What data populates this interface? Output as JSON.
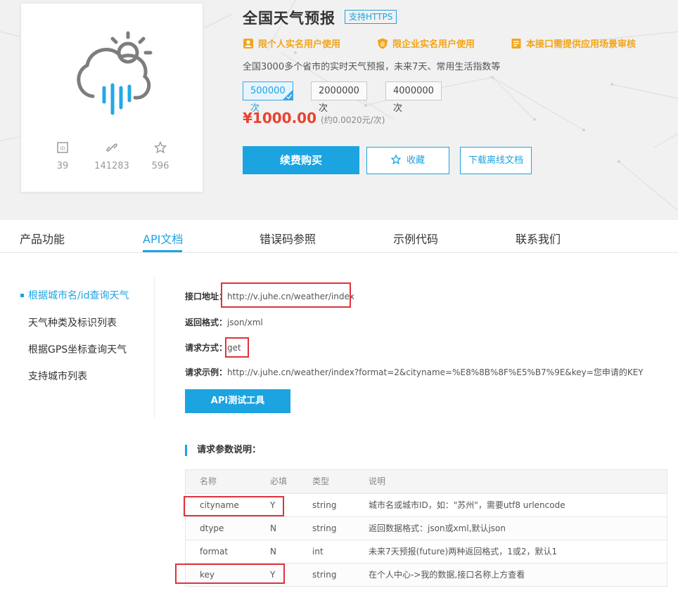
{
  "product": {
    "title": "全国天气预报",
    "https_badge": "支持HTTPS",
    "tags": [
      "限个人实名用户使用",
      "限企业实名用户使用",
      "本接口需提供应用场景审核"
    ],
    "description": "全国3000多个省市的实时天气预报，未来7天、常用生活指数等",
    "packages": [
      "500000次",
      "2000000次",
      "4000000次"
    ],
    "selected_package": "500000次",
    "price": "¥1000.00",
    "unit_price": "(约0.0020元/次)",
    "buttons": {
      "buy": "续费购买",
      "favorite": "收藏",
      "download": "下载离线文档"
    },
    "stats": [
      {
        "icon": "id-icon",
        "value": "39"
      },
      {
        "icon": "link-icon",
        "value": "141283"
      },
      {
        "icon": "star-icon",
        "value": "596"
      }
    ]
  },
  "tabs": [
    "产品功能",
    "API文档",
    "错误码参照",
    "示例代码",
    "联系我们"
  ],
  "active_tab": "API文档",
  "sidebar": {
    "items": [
      "根据城市名/id查询天气",
      "天气种类及标识列表",
      "根据GPS坐标查询天气",
      "支持城市列表"
    ],
    "active": "根据城市名/id查询天气"
  },
  "api": {
    "url_label": "接口地址：",
    "url": "http://v.juhe.cn/weather/index",
    "format_label": "返回格式：",
    "format": "json/xml",
    "method_label": "请求方式：",
    "method": "get",
    "example_label": "请求示例：",
    "example": "http://v.juhe.cn/weather/index?format=2&cityname=%E8%8B%8F%E5%B7%9E&key=您申请的KEY",
    "test_button": "API测试工具",
    "params_title": "请求参数说明：",
    "table": {
      "headers": [
        "名称",
        "必填",
        "类型",
        "说明"
      ],
      "rows": [
        [
          "cityname",
          "Y",
          "string",
          "城市名或城市ID，如：\"苏州\"，需要utf8 urlencode"
        ],
        [
          "dtype",
          "N",
          "string",
          "返回数据格式：json或xml,默认json"
        ],
        [
          "format",
          "N",
          "int",
          "未来7天预报(future)两种返回格式，1或2，默认1"
        ],
        [
          "key",
          "Y",
          "string",
          "在个人中心->我的数据,接口名称上方查看"
        ]
      ]
    }
  },
  "colors": {
    "accent": "#1ca4e0",
    "price": "#e8432f",
    "tag": "#f2a51a",
    "highlight_box": "#e0323a"
  }
}
